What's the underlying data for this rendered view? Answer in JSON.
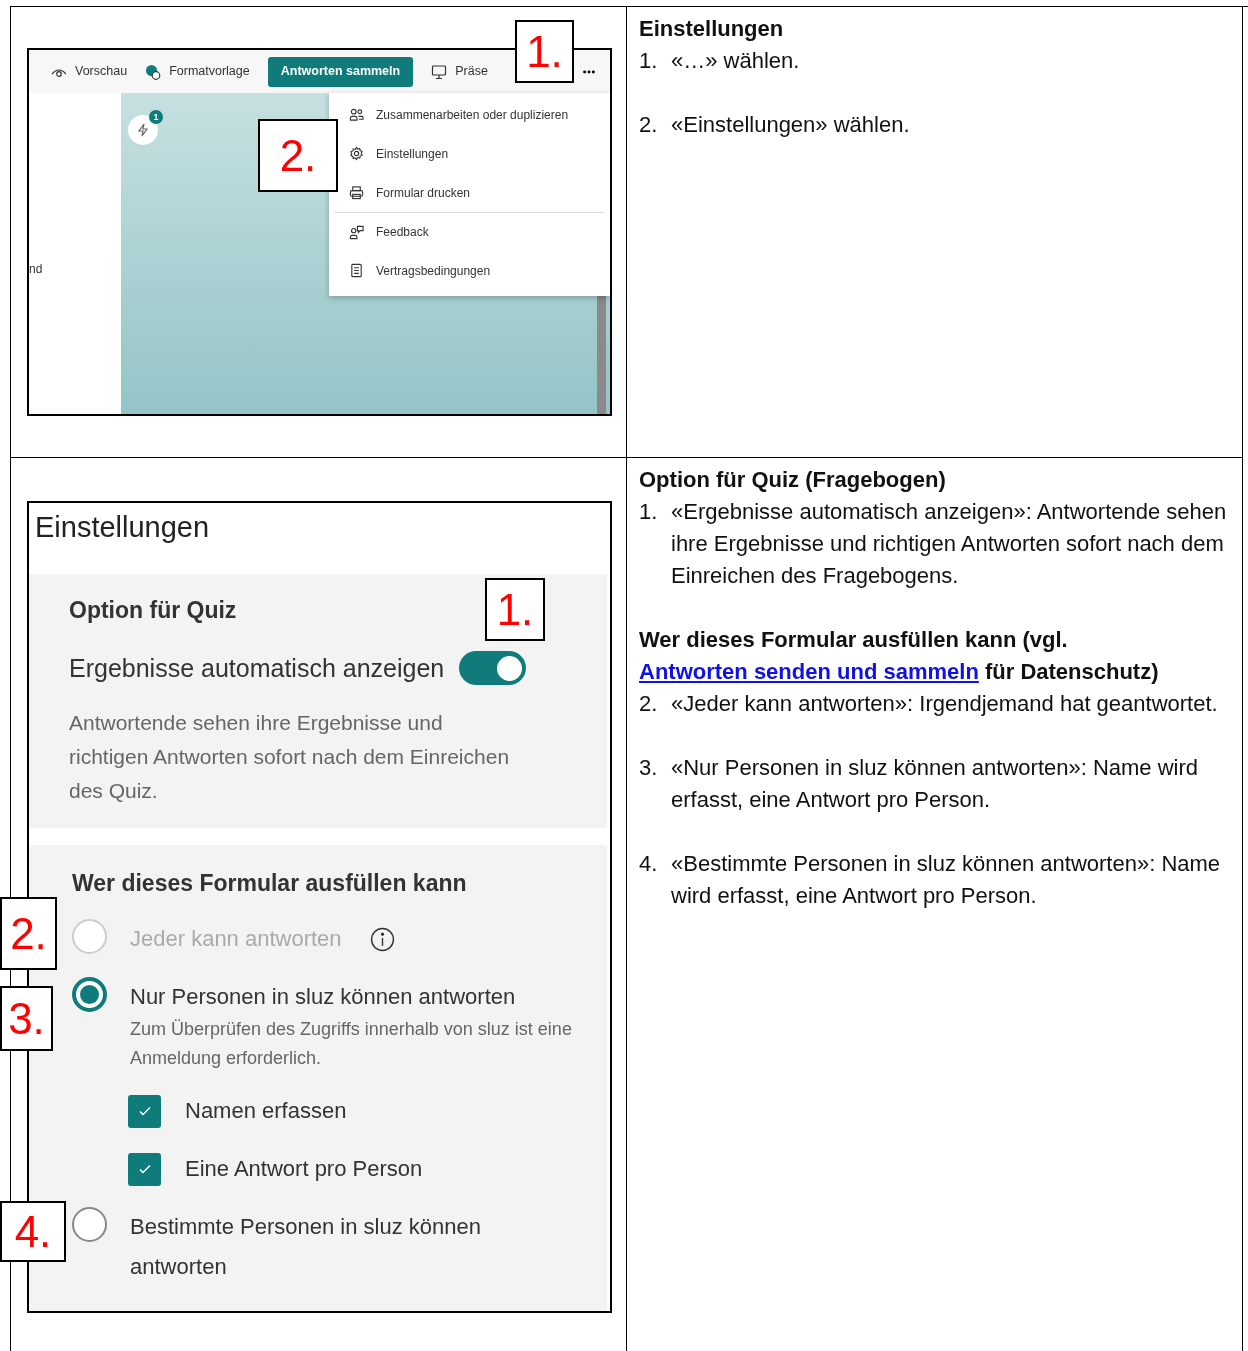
{
  "rows": [
    {
      "screenshot": {
        "kind": "menu",
        "toolbar": [
          {
            "label": "Vorschau",
            "kind": "plain"
          },
          {
            "label": "Formatvorlage",
            "kind": "plain"
          },
          {
            "label": "Antworten sammeln",
            "kind": "primary"
          },
          {
            "label": "Präse",
            "kind": "plain"
          }
        ],
        "badge": "1",
        "partial_text": "nd",
        "menu": [
          {
            "label": "Zusammenarbeiten oder duplizieren",
            "divider_before": false
          },
          {
            "label": "Einstellungen",
            "divider_before": false
          },
          {
            "label": "Formular drucken",
            "divider_before": false
          },
          {
            "label": "Feedback",
            "divider_before": true
          },
          {
            "label": "Vertragsbedingungen",
            "divider_before": false
          }
        ],
        "callouts": [
          {
            "label": "1."
          },
          {
            "label": "2."
          }
        ]
      },
      "notes": [
        {
          "kind": "title",
          "text": "Einstellungen"
        },
        {
          "kind": "step",
          "number": "1.",
          "text": "«…» wählen."
        },
        {
          "kind": "step",
          "number": "2.",
          "text": "«Einstellungen» wählen."
        }
      ]
    },
    {
      "screenshot": {
        "kind": "settings",
        "title": "Einstellungen",
        "quiz": {
          "heading": "Option für Quiz",
          "toggle_label": "Ergebnisse automatisch anzeigen",
          "on": true,
          "description": "Antwortende sehen ihre Ergebnisse und richtigen Antworten sofort nach dem Einreichen des Quiz."
        },
        "access": {
          "heading": "Wer dieses Formular ausfüllen kann",
          "options": [
            {
              "label": "Jeder kann antworten",
              "selected": false,
              "disabled": true,
              "info": true
            },
            {
              "label": "Nur Personen in sluz können antworten",
              "selected": true,
              "disabled": false,
              "description": "Zum Überprüfen des Zugriffs innerhalb von sluz ist eine Anmeldung erforderlich.",
              "checkboxes": [
                {
                  "label": "Namen erfassen",
                  "checked": true
                },
                {
                  "label": "Eine Antwort pro Person",
                  "checked": true
                }
              ]
            },
            {
              "label": "Bestimmte Personen in sluz können antworten",
              "selected": false,
              "disabled": false
            }
          ]
        },
        "callouts": [
          {
            "label": "1."
          },
          {
            "label": "2."
          },
          {
            "label": "3."
          },
          {
            "label": "4."
          }
        ]
      },
      "notes": [
        {
          "kind": "title",
          "text": "Option für Quiz (Fragebogen)"
        },
        {
          "kind": "step",
          "number": "1.",
          "text": "«Ergebnisse automatisch anzeigen»: Antwortende sehen ihre Ergebnisse und richtigen Antworten sofort nach dem Einreichen des Fragebogens."
        },
        {
          "kind": "link_heading",
          "before": "Wer dieses Formular ausfüllen kann (vgl. ",
          "link": "Antworten senden und sammeln",
          "after": " für Datenschutz)"
        },
        {
          "kind": "step",
          "number": "2.",
          "text": "«Jeder kann antworten»: Irgendjemand hat geantwortet."
        },
        {
          "kind": "step",
          "number": "3.",
          "text": "«Nur Personen in sluz können antworten»: Name wird erfasst, eine Antwort pro Person."
        },
        {
          "kind": "step",
          "number": "4.",
          "text": "«Bestimmte Personen in sluz können antworten»: Name wird erfasst, eine Antwort pro Person."
        }
      ]
    }
  ]
}
